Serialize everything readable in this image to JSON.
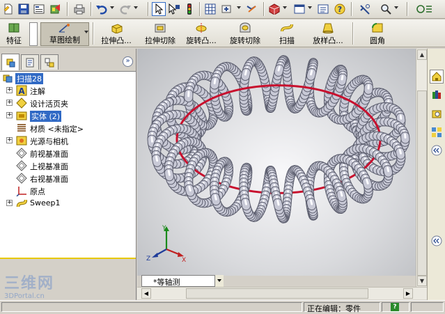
{
  "feature_toolbar": {
    "features_label": "特征",
    "sketch_label": "草图绘制",
    "extrude_boss_label": "拉伸凸...",
    "extrude_cut_label": "拉伸切除",
    "revolve_boss_label": "旋转凸...",
    "revolve_cut_label": "旋转切除",
    "sweep_label": "扫描",
    "loft_label": "放样凸...",
    "fillet_label": "圆角"
  },
  "tree": {
    "root": "扫描28",
    "items": [
      {
        "label": "注解",
        "icon": "annotations-icon",
        "expandable": true
      },
      {
        "label": "设计活页夹",
        "icon": "design-binder-icon",
        "expandable": true
      },
      {
        "label": "实体 (2)",
        "icon": "solid-bodies-icon",
        "expandable": true,
        "selected": true
      },
      {
        "label": "材质 <未指定>",
        "icon": "material-icon",
        "expandable": false
      },
      {
        "label": "光源与相机",
        "icon": "lights-cameras-icon",
        "expandable": true
      },
      {
        "label": "前视基准面",
        "icon": "plane-icon",
        "expandable": false
      },
      {
        "label": "上视基准面",
        "icon": "plane-icon",
        "expandable": false
      },
      {
        "label": "右视基准面",
        "icon": "plane-icon",
        "expandable": false
      },
      {
        "label": "原点",
        "icon": "origin-icon",
        "expandable": false
      },
      {
        "label": "Sweep1",
        "icon": "sweep-feature-icon",
        "expandable": true
      }
    ]
  },
  "viewport": {
    "view_orientation": "*等轴测",
    "triad": {
      "x": "X",
      "y": "Y",
      "z": "Z"
    }
  },
  "status": {
    "text": "正在编辑：零件",
    "help": "?"
  },
  "watermark": {
    "line1": "三维网",
    "line2": "3DPortal.cn"
  },
  "colors": {
    "selection": "#316ac5",
    "tube": "#c8c9d6",
    "path": "#c8102e",
    "tree_divider": "#e8c800"
  }
}
